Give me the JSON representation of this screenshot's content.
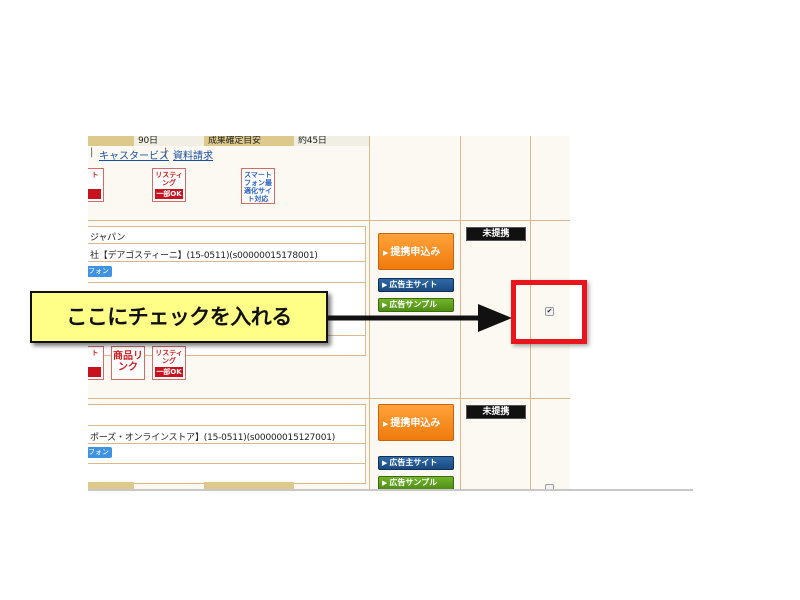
{
  "colors": {
    "accent_red": "#e8161c",
    "callout_yellow": "#ffff88",
    "orange_button": "#f07a0c",
    "navy_button": "#1a4a80",
    "green_button": "#4f8d14"
  },
  "row1": {
    "partial_cells": [
      "90日",
      "成果確定目安",
      "約45日"
    ],
    "links": [
      "キャスタービズ",
      "資料請求"
    ],
    "separators": [
      "|",
      "|"
    ],
    "features": [
      {
        "top": "ト",
        "bottom": "",
        "icon": "feature-partial-icon"
      },
      {
        "top": "リスティング",
        "bottom": "一部OK",
        "icon": "listing-icon"
      },
      {
        "top": "スマートフォン最適化サイト対応",
        "bottom": "",
        "icon": "smartphone-optimized-icon"
      }
    ]
  },
  "row2": {
    "advertiser": "ジャパン",
    "program": "社【デアゴスティーニ】(15-0511)(s00000015178001)",
    "device_badge": "フォン",
    "features": [
      {
        "top": "ト",
        "bottom": "",
        "icon": "feature-partial-icon"
      },
      {
        "top": "商品リンク",
        "bottom": "",
        "icon": "product-link-icon"
      },
      {
        "top": "リスティング",
        "bottom": "一部OK",
        "icon": "listing-icon"
      }
    ],
    "apply_button": "提携申込み",
    "advertiser_site_button": "広告主サイト",
    "ad_sample_button": "広告サンプル",
    "status": "未提携",
    "checkbox_checked": true
  },
  "row3": {
    "program": "ポーズ・オンラインストア】(15-0511)(s00000015127001)",
    "device_badge": "フォン",
    "apply_button": "提携申込み",
    "advertiser_site_button": "広告主サイト",
    "ad_sample_button": "広告サンプル",
    "status": "未提携",
    "checkbox_checked": false
  },
  "annotation": {
    "callout_text": "ここにチェックを入れる"
  },
  "icons": {
    "play_triangle": "▶",
    "check_mark": "✔"
  }
}
